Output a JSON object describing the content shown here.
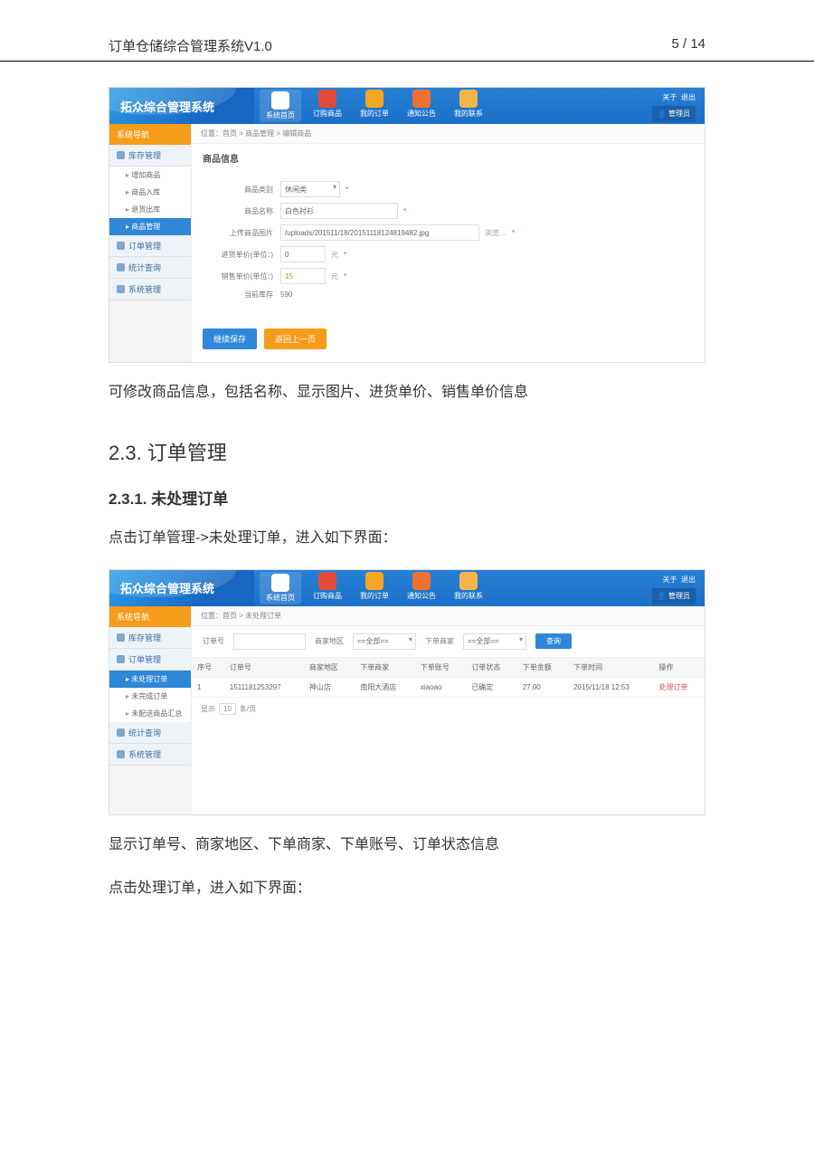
{
  "doc": {
    "title": "订单仓储综合管理系统V1.0",
    "page": "5 / 14",
    "para1": "可修改商品信息，包括名称、显示图片、进货单价、销售单价信息",
    "h2": "2.3. 订单管理",
    "h3": "2.3.1. 未处理订单",
    "para2": "点击订单管理->未处理订单，进入如下界面：",
    "para3": "显示订单号、商家地区、下单商家、下单账号、订单状态信息",
    "para4": "点击处理订单，进入如下界面："
  },
  "common": {
    "brand": "拓众综合管理系统",
    "topnav": [
      "系统首页",
      "订购商品",
      "我的订单",
      "通知公告",
      "我的联系"
    ],
    "user_about": "关于",
    "user_logout": "退出",
    "user_btn": "管理员",
    "side_title": "系统导航"
  },
  "s1": {
    "crumb": "位置：首页 > 商品管理 > 编辑商品",
    "side_groups": [
      "库存管理",
      "订单管理",
      "统计查询",
      "系统管理"
    ],
    "side_subs": [
      "增加商品",
      "商品入库",
      "退货出库",
      "商品管理"
    ],
    "panel_title": "商品信息",
    "rows": {
      "type_label": "商品类别",
      "type_value": "休闲类",
      "name_label": "商品名称",
      "name_value": "白色衬衫",
      "img_label": "上传商品图片",
      "img_value": "/uploads/201511/18/20151118124819482.jpg",
      "img_btn": "浏览…",
      "in_label": "进货单价(单位：)",
      "in_value": "0",
      "in_unit": "元",
      "out_label": "销售单价(单位：)",
      "out_value": "15",
      "out_unit": "元",
      "stock_label": "当前库存",
      "stock_value": "590"
    },
    "btn_save": "继续保存",
    "btn_back": "返回上一页"
  },
  "s2": {
    "crumb": "位置：首页 > 未处理订单",
    "side_groups": [
      "库存管理",
      "订单管理",
      "统计查询",
      "系统管理"
    ],
    "side_subs": [
      "未处理订单",
      "未完成订单",
      "未配送商品汇总"
    ],
    "filter": {
      "f1_label": "订单号",
      "f2_label": "商家地区",
      "f2_value": "==全部==",
      "f3_label": "下单商家",
      "f3_value": "==全部==",
      "btn": "查询"
    },
    "cols": [
      "序号",
      "订单号",
      "商家地区",
      "下单商家",
      "下单账号",
      "订单状态",
      "下单金额",
      "下单时间",
      "操作"
    ],
    "row": [
      "1",
      "1511181253297",
      "神山店",
      "南阳大酒店",
      "xiaoao",
      "已确定",
      "27.00",
      "2015/11/18 12:53",
      "处理订单"
    ],
    "pager_show": "显示",
    "pager_size": "10",
    "pager_unit": "条/页"
  }
}
